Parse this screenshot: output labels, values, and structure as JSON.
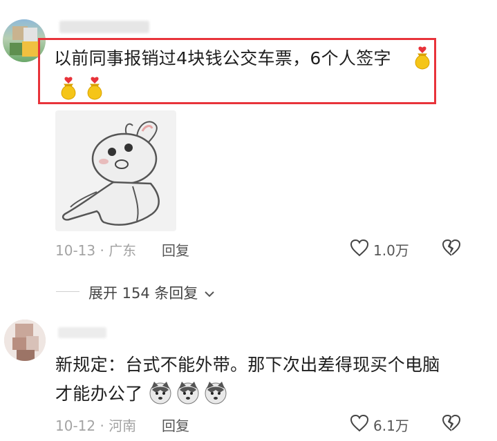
{
  "comments": [
    {
      "text_line1": "以前同事报销过4块钱公交车票，6个人签字",
      "date_location": "10-13 · 广东",
      "reply_label": "回复",
      "like_count": "1.0万",
      "expand_replies": "展开 154 条回复",
      "emoji": "money-bag-with-heart"
    },
    {
      "text_line1": "新规定：台式不能外带。那下次出差得现买个电脑",
      "text_line2": "才能办公了",
      "date_location": "10-12 · 河南",
      "reply_label": "回复",
      "like_count": "6.1万",
      "emoji": "husky-face"
    }
  ],
  "colors": {
    "highlight": "#e8333a",
    "meta": "#a3a3a3"
  }
}
